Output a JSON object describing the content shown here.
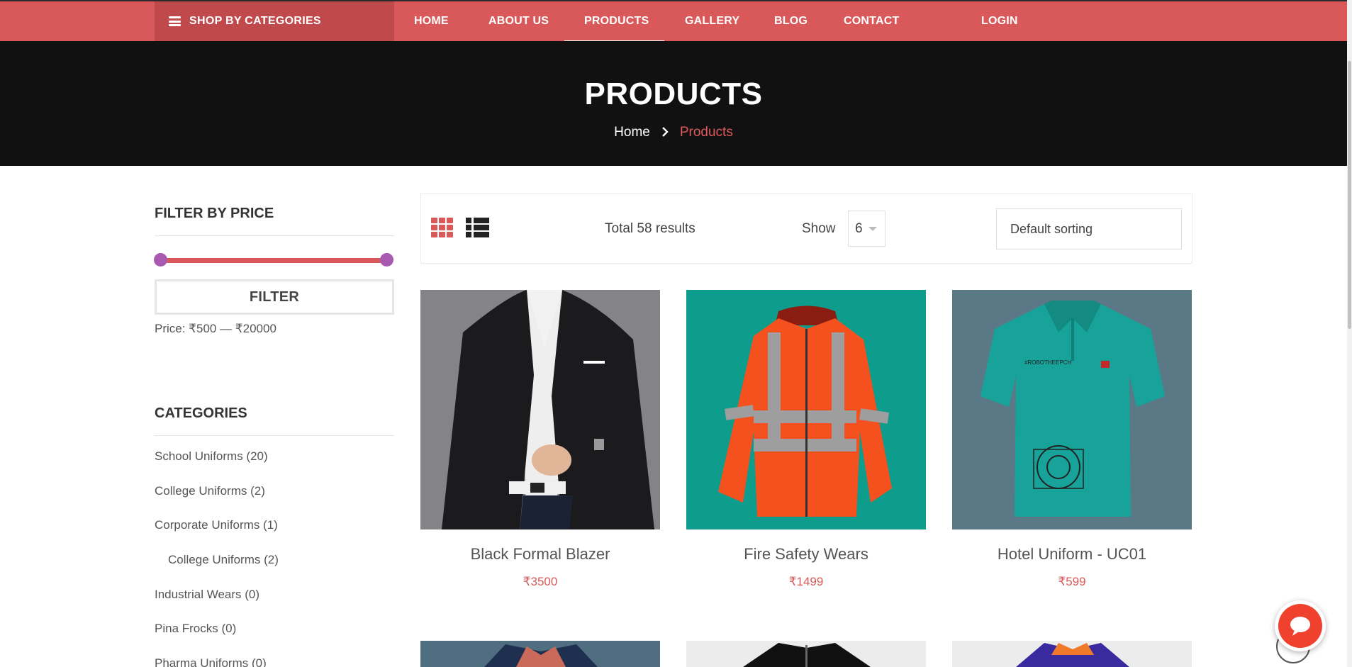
{
  "nav": {
    "shop_by_categories": "SHOP BY CATEGORIES",
    "items": [
      {
        "label": "HOME"
      },
      {
        "label": "ABOUT US"
      },
      {
        "label": "PRODUCTS",
        "active": true
      },
      {
        "label": "GALLERY"
      },
      {
        "label": "BLOG"
      },
      {
        "label": "CONTACT"
      },
      {
        "label": "LOGIN"
      }
    ]
  },
  "hero": {
    "title": "PRODUCTS",
    "breadcrumb": {
      "home": "Home",
      "current": "Products"
    }
  },
  "sidebar": {
    "price_heading": "FILTER BY PRICE",
    "filter_button": "FILTER",
    "price_range": "Price: ₹500 — ₹20000",
    "categories_heading": "CATEGORIES",
    "categories": [
      {
        "label": "School Uniforms (20)"
      },
      {
        "label": "College Uniforms (2)"
      },
      {
        "label": "Corporate Uniforms (1)"
      },
      {
        "label": "College Uniforms (2)",
        "indent": true
      },
      {
        "label": "Industrial Wears (0)"
      },
      {
        "label": "Pina Frocks (0)"
      },
      {
        "label": "Pharma Uniforms (0)"
      }
    ]
  },
  "toolbar": {
    "total": "Total 58 results",
    "show_label": "Show",
    "show_value": "6",
    "sorting": "Default sorting"
  },
  "products": [
    {
      "name": "Black Formal Blazer",
      "price": "₹3500",
      "icon": "blazer-image"
    },
    {
      "name": "Fire Safety Wears",
      "price": "₹1499",
      "icon": "safety-jacket-image"
    },
    {
      "name": "Hotel Uniform - UC01",
      "price": "₹599",
      "icon": "polo-shirt-image"
    }
  ],
  "colors": {
    "accent": "#d9595b",
    "hero_bg": "#111111",
    "chat": "#f0412f"
  }
}
